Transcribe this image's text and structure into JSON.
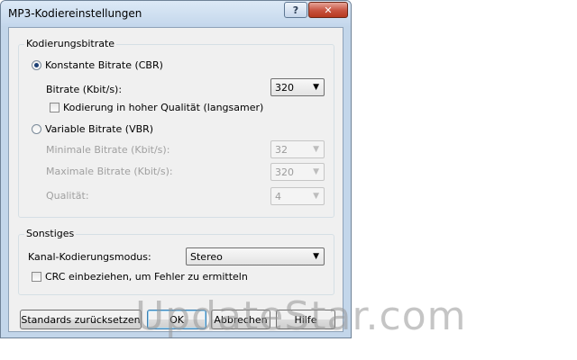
{
  "window": {
    "title": "MP3-Kodiereinstellungen"
  },
  "title_buttons": {
    "help": "?",
    "close": "✕"
  },
  "encoding": {
    "group_title": "Kodierungsbitrate",
    "cbr_label": "Konstante Bitrate (CBR)",
    "cbr_selected": true,
    "bitrate_label": "Bitrate (Kbit/s):",
    "bitrate_value": "320",
    "hq_label": "Kodierung in hoher Qualität (langsamer)",
    "hq_checked": false,
    "vbr_label": "Variable Bitrate (VBR)",
    "vbr_selected": false,
    "min_label": "Minimale Bitrate (Kbit/s):",
    "min_value": "32",
    "max_label": "Maximale Bitrate (Kbit/s):",
    "max_value": "320",
    "quality_label": "Qualität:",
    "quality_value": "4"
  },
  "misc": {
    "group_title": "Sonstiges",
    "channel_label": "Kanal-Kodierungsmodus:",
    "channel_value": "Stereo",
    "crc_label": "CRC einbeziehen, um Fehler zu ermitteln",
    "crc_checked": false
  },
  "buttons": {
    "reset": "Standards zurücksetzen",
    "ok": "OK",
    "cancel": "Abbrechen",
    "help": "Hilfe"
  },
  "watermark": "UpdateStar.com",
  "dropdown_arrow": "▼",
  "colors": {
    "frame": "#c3d6ea",
    "client": "#f0f0f0",
    "close_button": "#c7523e",
    "disabled_text": "#a0a0a0"
  }
}
